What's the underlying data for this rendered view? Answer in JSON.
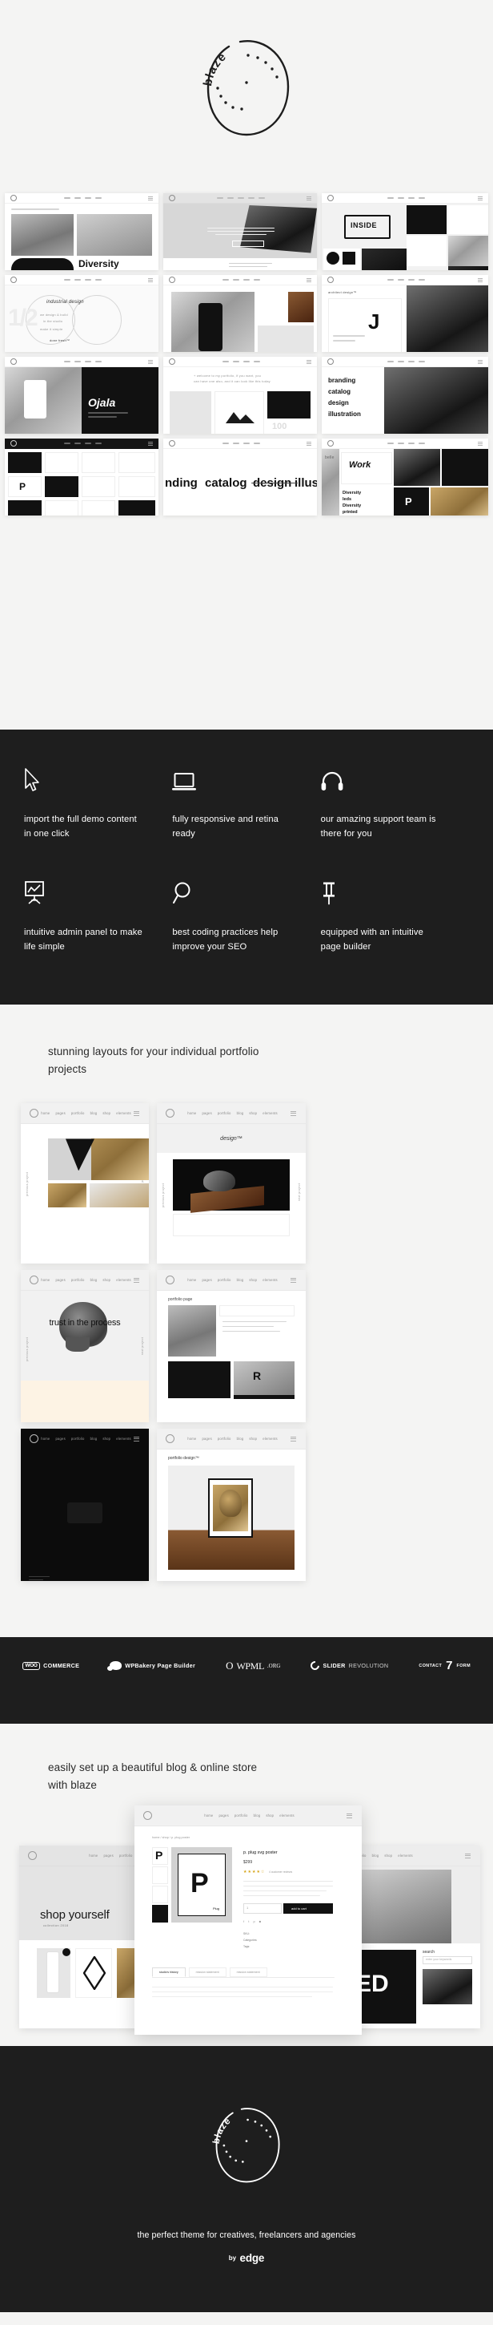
{
  "brand": {
    "name": "blaze",
    "tagline": "the perfect theme for creatives, freelancers and agencies",
    "author_prefix": "by",
    "author": "edge"
  },
  "hero": {
    "logo_text": "blaze",
    "logo_icon": "blaze-circle-logo"
  },
  "showcase": {
    "rows": [
      [
        {
          "label": "Diversity",
          "kind": "hands-and-bottles"
        },
        {
          "label": "",
          "kind": "ink-brush-grey"
        },
        {
          "label": "INSIDE",
          "kind": "inside-grid"
        }
      ],
      [
        {
          "label": "industrial design",
          "kind": "typography-circle"
        },
        {
          "label": "",
          "kind": "phone-in-hand"
        },
        {
          "label": "architect design",
          "kind": "portrait-split"
        }
      ],
      [
        {
          "label": "Ojala",
          "kind": "bottle-dark"
        },
        {
          "label": "",
          "kind": "mountain-grid"
        },
        {
          "label": "branding catalog design illustration",
          "kind": "glasses-portrait"
        }
      ],
      [
        {
          "label": "P",
          "kind": "poster-marks"
        },
        {
          "label": "branding catalog design illustration",
          "kind": "wordmarks"
        },
        {
          "label": "Work Diversity",
          "kind": "collage-dark"
        }
      ]
    ]
  },
  "features": {
    "items": [
      {
        "icon": "cursor-icon",
        "text": "import the full demo content in one click"
      },
      {
        "icon": "laptop-icon",
        "text": "fully responsive and retina ready"
      },
      {
        "icon": "headphones-icon",
        "text": "our amazing support team is there for you"
      },
      {
        "icon": "presentation-chart-icon",
        "text": "intuitive admin panel to make life simple"
      },
      {
        "icon": "magnifier-icon",
        "text": "best coding practices help improve your SEO"
      },
      {
        "icon": "pushpin-icon",
        "text": "equipped with an intuitive page builder"
      }
    ]
  },
  "portfolio": {
    "title": "stunning layouts for your individual portfolio projects",
    "frames": [
      {
        "nav": [
          "home",
          "pages",
          "portfolio",
          "blog",
          "shop",
          "elements"
        ],
        "heading": "",
        "side_left": "previous project",
        "side_right": "next project",
        "kind": "gold-skull"
      },
      {
        "nav": [
          "home",
          "pages",
          "portfolio",
          "blog",
          "shop",
          "elements"
        ],
        "heading": "design™",
        "side_left": "previous project",
        "side_right": "next project",
        "kind": "dark-lamp"
      },
      {
        "nav": [
          "home",
          "pages",
          "portfolio",
          "blog",
          "shop",
          "elements"
        ],
        "heading": "trust in the process",
        "side_left": "previous project",
        "side_right": "next project",
        "kind": "etched-skull"
      },
      {
        "nav": [
          "home",
          "pages",
          "portfolio",
          "blog",
          "shop",
          "elements"
        ],
        "heading": "portfolio page",
        "side_left": "",
        "side_right": "",
        "kind": "glove-hand"
      },
      {
        "nav": [
          "home",
          "pages",
          "portfolio",
          "blog",
          "shop",
          "elements"
        ],
        "heading": "",
        "side_left": "",
        "side_right": "",
        "kind": "black-minimal"
      },
      {
        "nav": [
          "home",
          "pages",
          "portfolio",
          "blog",
          "shop",
          "elements"
        ],
        "heading": "portfolio design™",
        "side_left": "",
        "side_right": "",
        "kind": "framed-skull"
      }
    ]
  },
  "logos": {
    "items": [
      {
        "name": "woocommerce-logo",
        "mark": "WOO",
        "label": "COMMERCE"
      },
      {
        "name": "wpbakery-logo",
        "mark": "",
        "label": "WPBakery Page Builder"
      },
      {
        "name": "wpml-logo",
        "mark": "WPML",
        "label": ".ORG"
      },
      {
        "name": "slider-revolution-logo",
        "mark": "SLIDER",
        "label": "REVOLUTION"
      },
      {
        "name": "contact-form-7-logo",
        "mark": "7",
        "label_left": "CONTACT",
        "label_right": "FORM"
      }
    ]
  },
  "shop": {
    "title": "easily set up a beautiful blog & online store with blaze",
    "mocks": [
      {
        "nav": [
          "home",
          "pages",
          "portfolio",
          "blog",
          "shop",
          "elements"
        ],
        "heading": "shop yourself",
        "sub": "collection 2018",
        "kind": "shop-landing"
      },
      {
        "nav": [
          "home",
          "pages",
          "portfolio",
          "blog",
          "shop",
          "elements"
        ],
        "heading": "",
        "kind": "blog-hand"
      },
      {
        "nav": [
          "home",
          "pages",
          "portfolio",
          "blog",
          "shop",
          "elements"
        ],
        "breadcrumb": "home / shop / p. plug poster",
        "product_title": "p. plug svg poster",
        "price": "$299",
        "rating": "4 customer reviews",
        "button": "add to cart",
        "qty": "1",
        "sku_label": "SKU:",
        "category_label": "Categories:",
        "tag_label": "Tags:",
        "tabs": [
          "studio's history",
          "mission statement",
          "mission statement"
        ],
        "kind": "product-detail"
      }
    ],
    "sidebar": {
      "search_label": "search",
      "search_placeholder": "enter your keywords"
    }
  }
}
